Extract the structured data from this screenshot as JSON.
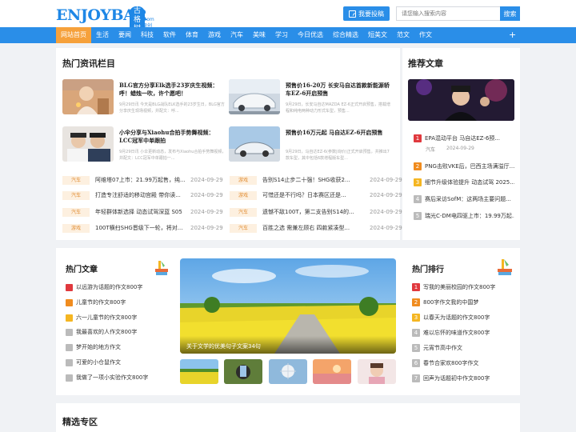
{
  "header": {
    "logo_text": "ENJOYBAR",
    "logo_badge": "古格树下",
    "logo_sub": ".com 原创文学",
    "submit_label": "我要投稿",
    "search_placeholder": "请您输入搜索内容",
    "search_button": "搜索"
  },
  "nav": {
    "items": [
      "网站首页",
      "生活",
      "要闻",
      "科技",
      "软件",
      "体育",
      "游戏",
      "汽车",
      "美味",
      "学习",
      "今日优选",
      "综合精选",
      "短美文",
      "范文",
      "作文"
    ],
    "plus": "+"
  },
  "hot_news": {
    "title": "热门资讯栏目",
    "cards": [
      {
        "title": "BLG官方分享Elk选手23岁庆生视频：呼！蜡烛一吹，许个愿吧！",
        "desc": "9月29日讯 今天是BLG战队ELK选手的23岁生日，BLG官方分享庆生现场视频，并配文：呼..."
      },
      {
        "title": "预售价16-20万 长安马自达首款新能源轿车EZ-6开启预售",
        "desc": "9月29日，长安马自达MAZDA EZ-6正式开启预售，搭载增程和纯电两种动力形式车型，预售..."
      },
      {
        "title": "小伞分享与Xiaohu合拍手势舞视频：LCC冠军中单跟拍",
        "desc": "9月29日讯 小伞更新动态，发布与Xiaohu合拍手势舞视频，并配文：LCC冠军中单跟拍一..."
      },
      {
        "title": "预售价16万元起 马自达EZ-6开启预售",
        "desc": "9月29日，马自达EZ-6(参数|询价)正式开启预售，共推出7款车型，其中包括6款增程版车型..."
      }
    ],
    "rows_left": [
      {
        "tag": "汽车",
        "title": "阿维塔07上市：21.99万起售，纯...",
        "date": "2024-09-29"
      },
      {
        "tag": "汽车",
        "title": "打造专注舒适的移动宫殿 带你读...",
        "date": "2024-09-29"
      },
      {
        "tag": "汽车",
        "title": "年轻群体新选择 动态试驾深蓝 S05",
        "date": "2024-09-29"
      },
      {
        "tag": "游戏",
        "title": "100T横扫SHG晋级下一轮，将对...",
        "date": "2024-09-29"
      }
    ],
    "rows_right": [
      {
        "tag": "游戏",
        "title": "告别S14止步二十强！SHG收获2...",
        "date": "2024-09-29"
      },
      {
        "tag": "游戏",
        "title": "可惜还是不行吗？日本赛区还是...",
        "date": "2024-09-29"
      },
      {
        "tag": "汽车",
        "title": "遗憾不敌100T，第二支告别S14的...",
        "date": "2024-09-29"
      },
      {
        "tag": "汽车",
        "title": "百胜之选 需兼左顾右 四款紧凑型...",
        "date": "2024-09-29"
      }
    ]
  },
  "recommended": {
    "title": "推荐文章",
    "items": [
      {
        "num": "1",
        "title": "EPA混动平台 马自达EZ-6预...",
        "color": "#e0393e"
      },
      {
        "num": "2",
        "title": "PNG击败VKE后，巴西主场满溢厅...",
        "color": "#f08c1f"
      },
      {
        "num": "3",
        "title": "细节升级体验提升 动态试驾 2025...",
        "color": "#f5b622"
      },
      {
        "num": "4",
        "title": "赛后采访SofM：这两场主要问题...",
        "color": "#999999"
      },
      {
        "num": "5",
        "title": "瑞光C-DM电四驱上市：19.99万起...",
        "color": "#999999"
      }
    ],
    "first_tag": "汽车",
    "first_date": "2024-09-29"
  },
  "hot_articles": {
    "title": "热门文章",
    "items": [
      {
        "title": "以远游为话题的作文800字",
        "color": "#e0393e"
      },
      {
        "title": "儿童节的作文800字",
        "color": "#f08c1f"
      },
      {
        "title": "六一儿童节的作文800字",
        "color": "#f5b622"
      },
      {
        "title": "我最喜欢的人作文800字",
        "color": "#bbbbbb"
      },
      {
        "title": "梦开始的地方作文",
        "color": "#bbbbbb"
      },
      {
        "title": "可爱的小仓鼠作文",
        "color": "#bbbbbb"
      },
      {
        "title": "我做了一项小实验作文800字",
        "color": "#bbbbbb"
      }
    ]
  },
  "hero": {
    "caption": "关于文学的优美句子文案34句"
  },
  "hot_rank": {
    "title": "热门排行",
    "items": [
      {
        "num": "1",
        "title": "写我的美丽校园的作文800字",
        "color": "#e0393e"
      },
      {
        "num": "2",
        "title": "800字作文我的中国梦",
        "color": "#f08c1f"
      },
      {
        "num": "3",
        "title": "以春天为话题的作文800字",
        "color": "#f5b622"
      },
      {
        "num": "4",
        "title": "难以忘怀的味道作文800字",
        "color": "#bbbbbb"
      },
      {
        "num": "5",
        "title": "元宵节高中作文",
        "color": "#bbbbbb"
      },
      {
        "num": "6",
        "title": "春节合家欢800字作文",
        "color": "#bbbbbb"
      },
      {
        "num": "7",
        "title": "回声为话题初中作文800字",
        "color": "#bbbbbb"
      }
    ]
  },
  "featured": {
    "title": "精选专区"
  }
}
